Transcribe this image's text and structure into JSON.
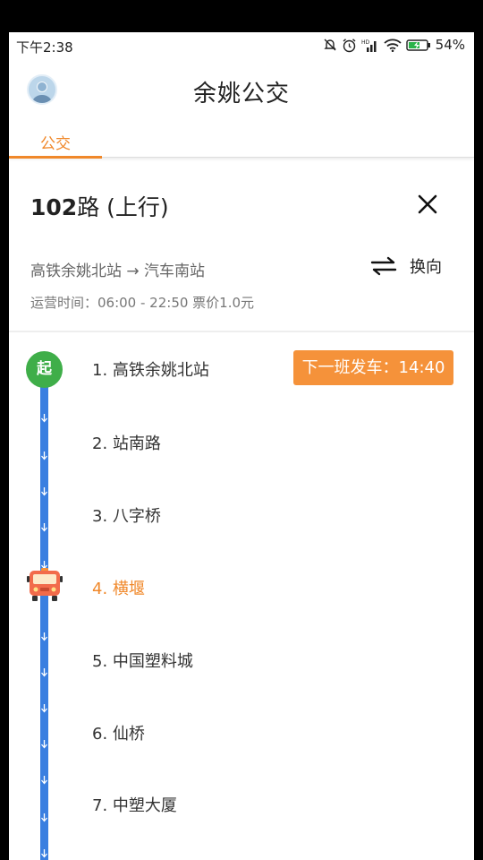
{
  "status": {
    "time": "下午2:38",
    "battery": "54%"
  },
  "header": {
    "title": "余姚公交"
  },
  "tabs": [
    {
      "label": "公交",
      "active": true
    }
  ],
  "route": {
    "name_num": "102",
    "name_rest": "路 (上行)",
    "direction": "高铁余姚北站 → 汽车南站",
    "switch_label": "换向",
    "meta": "运营时间：06:00 - 22:50   票价1.0元"
  },
  "start_marker": "起",
  "next_departure": "下一班发车：14:40",
  "stops": [
    {
      "label": "1. 高铁余姚北站"
    },
    {
      "label": "2. 站南路"
    },
    {
      "label": "3. 八字桥"
    },
    {
      "label": "4. 横堰",
      "current": true
    },
    {
      "label": "5. 中国塑料城"
    },
    {
      "label": "6. 仙桥"
    },
    {
      "label": "7. 中塑大厦"
    }
  ],
  "colors": {
    "accent": "#f0882a",
    "track": "#3a7fe0",
    "start": "#3fae49"
  },
  "icons": [
    "mute-bell-icon",
    "alarm-icon",
    "signal-icon",
    "wifi-icon",
    "battery-icon",
    "avatar-icon",
    "close-icon",
    "swap-arrows-icon",
    "bus-icon",
    "down-arrow-icon"
  ]
}
